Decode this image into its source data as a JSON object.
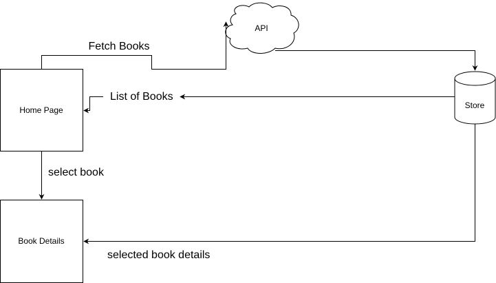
{
  "nodes": {
    "home_page": "Home Page",
    "book_details": "Book Details",
    "api": "API",
    "store": "Store"
  },
  "edges": {
    "fetch_books": "Fetch Books",
    "list_of_books": "List of Books",
    "select_book": "select book",
    "selected_book_details": "selected book details"
  },
  "colors": {
    "stroke": "#000000",
    "fill": "#ffffff",
    "text": "#000000"
  }
}
